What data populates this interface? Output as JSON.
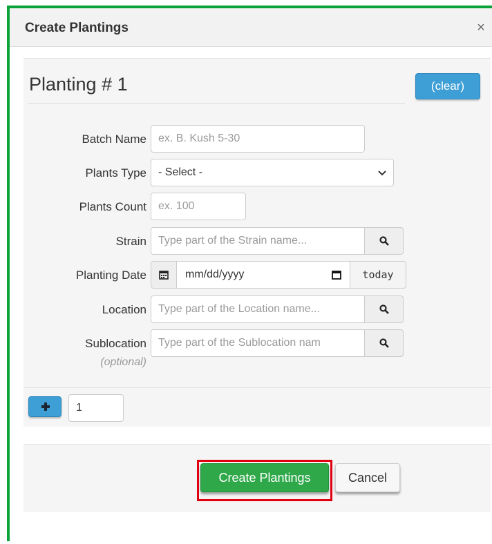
{
  "dialog": {
    "title": "Create Plantings",
    "close_glyph": "×"
  },
  "planting": {
    "heading": "Planting # 1",
    "clear_label": "(clear)"
  },
  "form": {
    "batch_name": {
      "label": "Batch Name",
      "placeholder": "ex. B. Kush 5-30"
    },
    "plants_type": {
      "label": "Plants Type",
      "selected": "- Select -"
    },
    "plants_count": {
      "label": "Plants Count",
      "placeholder": "ex. 100"
    },
    "strain": {
      "label": "Strain",
      "placeholder": "Type part of the Strain name..."
    },
    "planting_date": {
      "label": "Planting Date",
      "value": "mm/dd/yyyy",
      "today_label": "today"
    },
    "location": {
      "label": "Location",
      "placeholder": "Type part of the Location name..."
    },
    "sublocation": {
      "label": "Sublocation",
      "optional_note": "(optional)",
      "placeholder": "Type part of the Sublocation nam"
    }
  },
  "add_row": {
    "count_value": "1"
  },
  "actions": {
    "create_label": "Create Plantings",
    "cancel_label": "Cancel"
  },
  "icons": {
    "close": "close-icon",
    "search": "search-icon",
    "calendar": "calendar-icon",
    "plus": "plus-icon",
    "chevron": "chevron-down-icon"
  },
  "colors": {
    "frame_border": "#0aa33a",
    "primary_blue": "#3e9fd7",
    "success_green": "#2fa84a",
    "highlight_red": "#e00012"
  }
}
